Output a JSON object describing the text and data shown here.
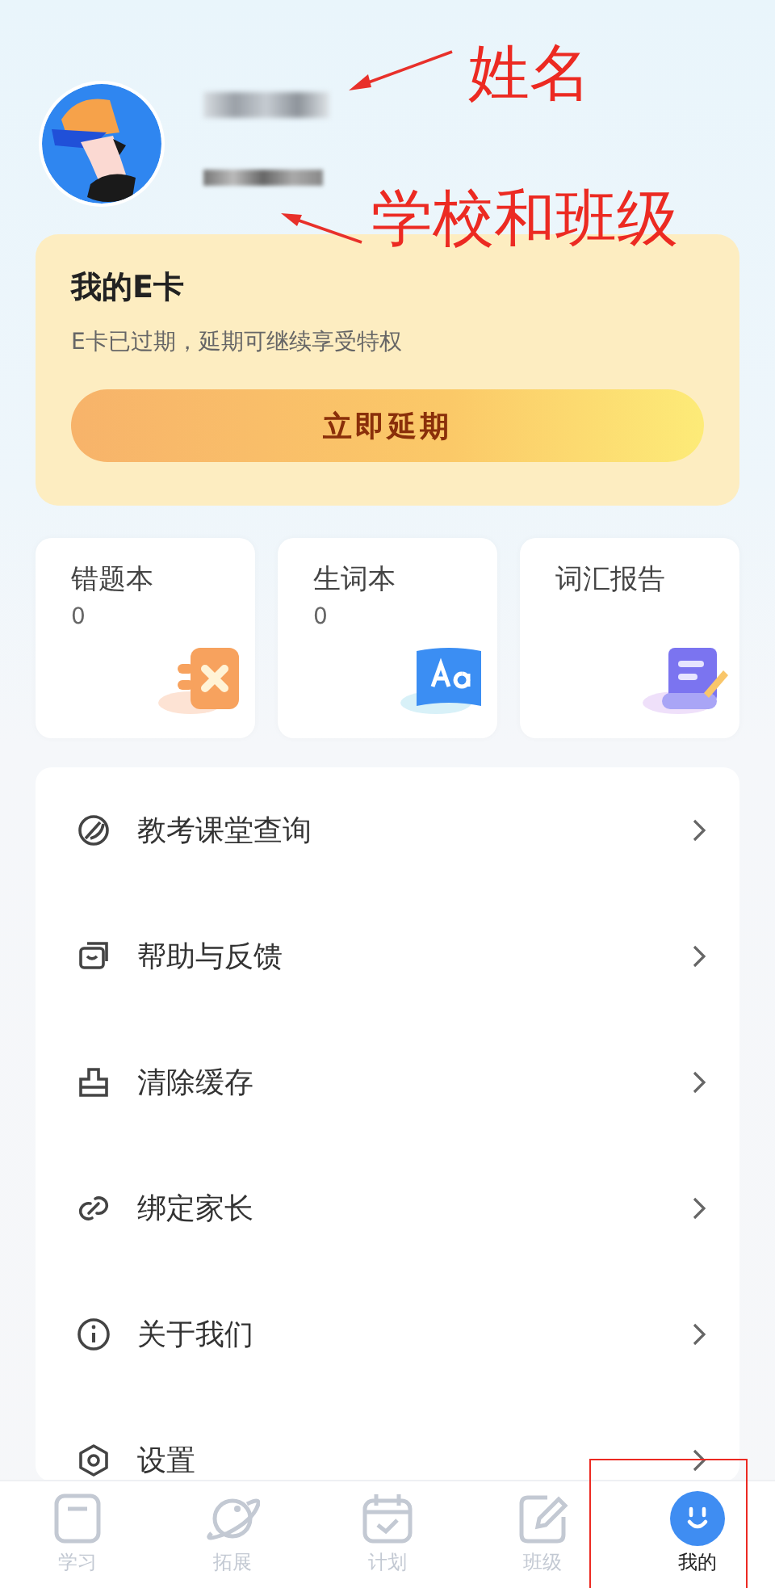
{
  "profile": {
    "name_blurred": true,
    "school_blurred": true
  },
  "ecard": {
    "title": "我的E卡",
    "subtitle": "E卡已过期，延期可继续享受特权",
    "button": "立即延期"
  },
  "shortcuts": [
    {
      "kind": "mistakes",
      "title": "错题本",
      "count": "0"
    },
    {
      "kind": "words",
      "title": "生词本",
      "count": "0"
    },
    {
      "kind": "report",
      "title": "词汇报告"
    }
  ],
  "menu": [
    {
      "kind": "classroom",
      "label": "教考课堂查询"
    },
    {
      "kind": "help",
      "label": "帮助与反馈"
    },
    {
      "kind": "cache",
      "label": "清除缓存"
    },
    {
      "kind": "parent",
      "label": "绑定家长"
    },
    {
      "kind": "about",
      "label": "关于我们"
    },
    {
      "kind": "settings",
      "label": "设置"
    }
  ],
  "tabs": [
    {
      "kind": "study",
      "label": "学习",
      "selected": false
    },
    {
      "kind": "explore",
      "label": "拓展",
      "selected": false
    },
    {
      "kind": "plan",
      "label": "计划",
      "selected": false
    },
    {
      "kind": "class",
      "label": "班级",
      "selected": false
    },
    {
      "kind": "me",
      "label": "我的",
      "selected": true
    }
  ],
  "annotations": [
    {
      "kind": "name",
      "text": "姓名"
    },
    {
      "kind": "school",
      "text": "学校和班级"
    },
    {
      "kind": "tab-box"
    }
  ]
}
